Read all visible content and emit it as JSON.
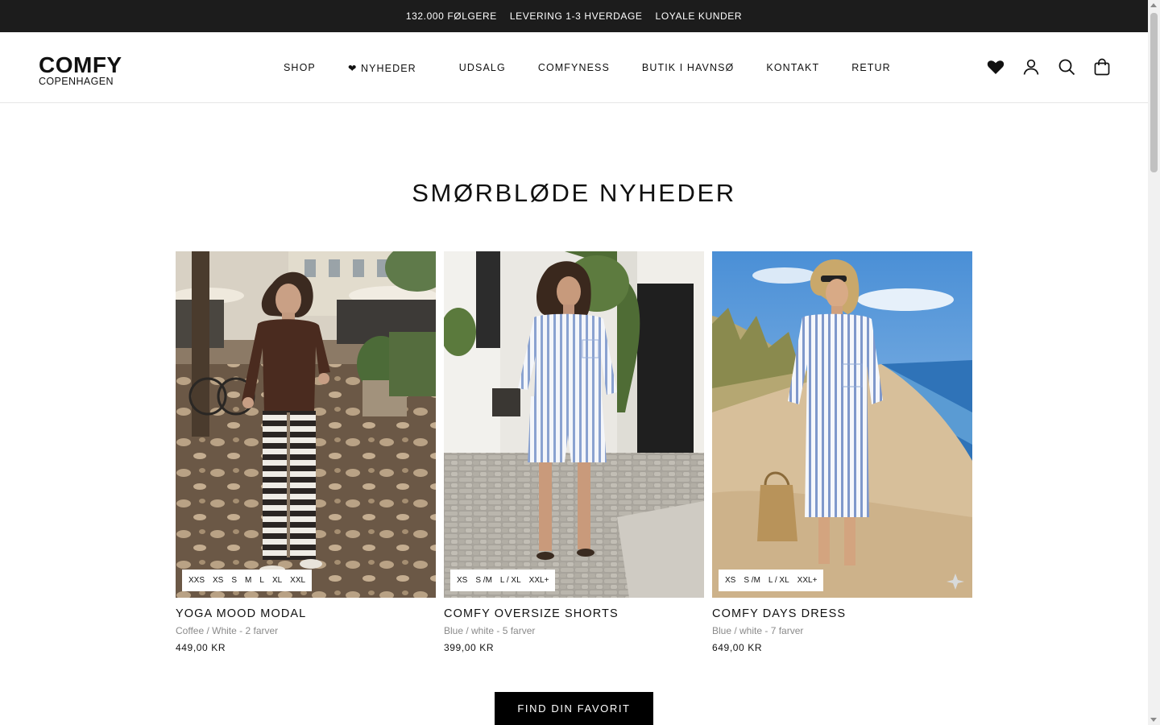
{
  "announcement": {
    "items": [
      "132.000 FØLGERE",
      "LEVERING 1-3 HVERDAGE",
      "LOYALE KUNDER"
    ]
  },
  "header": {
    "logo_line1": "COMFY",
    "logo_line2": "COPENHAGEN",
    "nav": [
      "SHOP",
      "❤ NYHEDER",
      "UDSALG",
      "COMFYNESS",
      "BUTIK I HAVNSØ",
      "KONTAKT",
      "RETUR"
    ],
    "icons": [
      "heart-icon",
      "account-icon",
      "search-icon",
      "bag-icon"
    ]
  },
  "section": {
    "title": "SMØRBLØDE NYHEDER"
  },
  "products": [
    {
      "name": "YOGA MOOD MODAL",
      "variant": "Coffee / White - 2 farver",
      "price": "449,00 KR",
      "sizes": [
        "XXS",
        "XS",
        "S",
        "M",
        "L",
        "XL",
        "XXL"
      ]
    },
    {
      "name": "COMFY OVERSIZE SHORTS",
      "variant": "Blue / white - 5 farver",
      "price": "399,00 KR",
      "sizes": [
        "XS",
        "S /M",
        "L / XL",
        "XXL+"
      ]
    },
    {
      "name": "COMFY DAYS DRESS",
      "variant": "Blue / white - 7 farver",
      "price": "649,00 KR",
      "sizes": [
        "XS",
        "S /M",
        "L / XL",
        "XXL+"
      ]
    }
  ],
  "cta": {
    "label": "FIND DIN FAVORIT"
  },
  "colors": {
    "announcement_bg": "#1c1c1c",
    "text": "#111111",
    "muted": "#8a8a8a",
    "button_bg": "#000000"
  }
}
